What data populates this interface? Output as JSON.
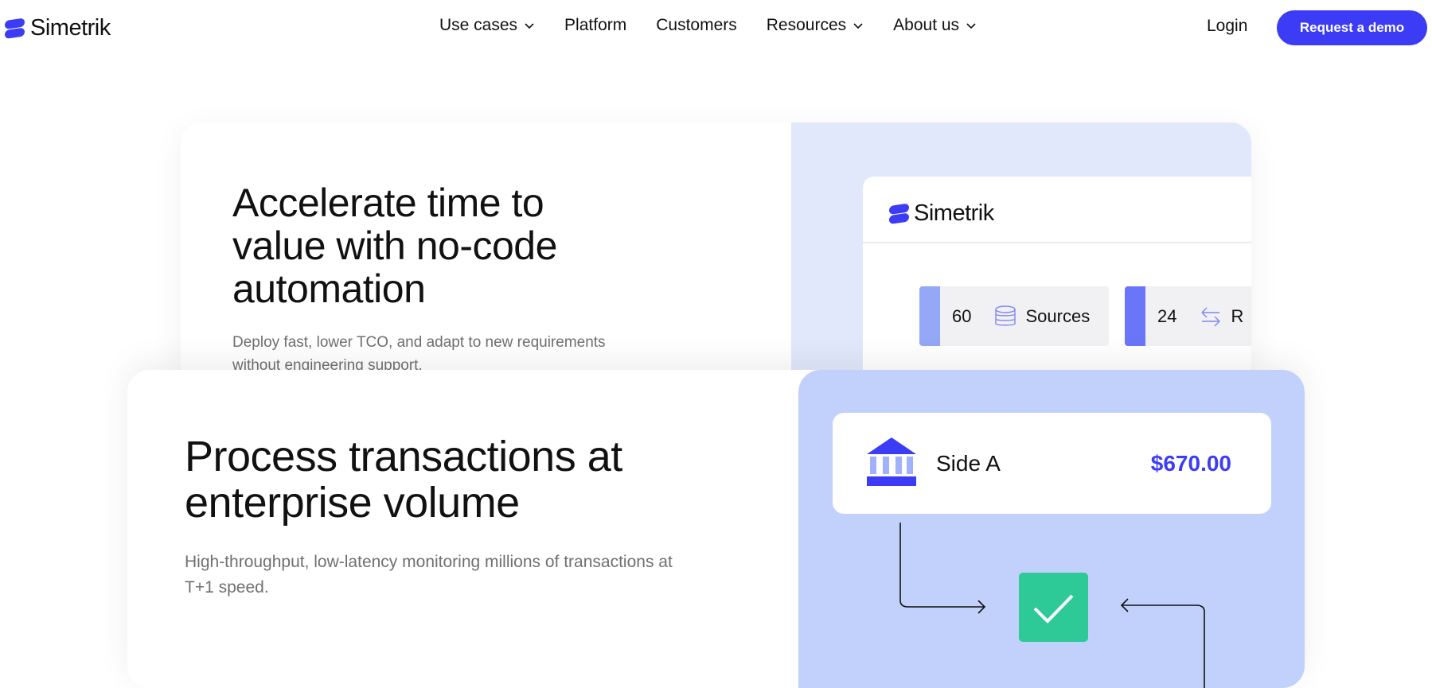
{
  "brand": {
    "name": "Simetrik",
    "accent": "#3c3cf6"
  },
  "nav": {
    "items": [
      {
        "label": "Use cases",
        "dropdown": true
      },
      {
        "label": "Platform",
        "dropdown": false
      },
      {
        "label": "Customers",
        "dropdown": false
      },
      {
        "label": "Resources",
        "dropdown": true
      },
      {
        "label": "About us",
        "dropdown": true
      }
    ],
    "login_label": "Login",
    "cta_label": "Request a demo"
  },
  "section1": {
    "title": "Accelerate time to value with no-code automation",
    "subtitle": "Deploy fast, lower TCO, and adapt to new requirements without engineering support.",
    "mock": {
      "logo_text": "Simetrik",
      "stats": [
        {
          "value": "60",
          "label": "Sources",
          "icon": "database-icon",
          "bar_color": "#94a8f7"
        },
        {
          "value": "24",
          "label": "R",
          "icon": "swap-arrows-icon",
          "bar_color": "#6a75f8"
        }
      ]
    }
  },
  "section2": {
    "title": "Process transactions at enterprise volume",
    "subtitle": "High-throughput, low-latency monitoring millions of transactions at T+1 speed.",
    "visual": {
      "side_label": "Side A",
      "amount": "$670.00",
      "check_color": "#2dc997",
      "bank_icon": "bank-icon"
    }
  }
}
